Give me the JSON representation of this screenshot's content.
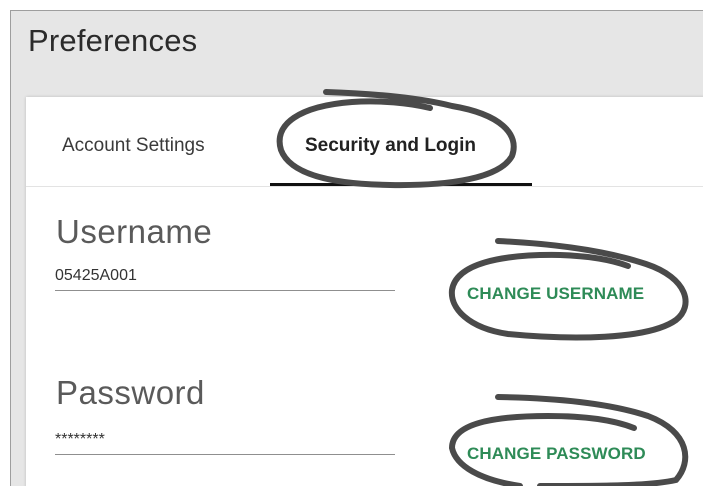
{
  "window": {
    "title": "Preferences"
  },
  "tabs": [
    {
      "label": "Account Settings",
      "active": false
    },
    {
      "label": "Security and Login",
      "active": true
    }
  ],
  "username": {
    "heading": "Username",
    "value": "05425A001",
    "action_label": "CHANGE USERNAME"
  },
  "password": {
    "heading": "Password",
    "value": "********",
    "action_label": "CHANGE PASSWORD"
  },
  "colors": {
    "accent": "#2e8b57",
    "annotation": "#4a4a4a",
    "tab_indicator": "#111111"
  }
}
